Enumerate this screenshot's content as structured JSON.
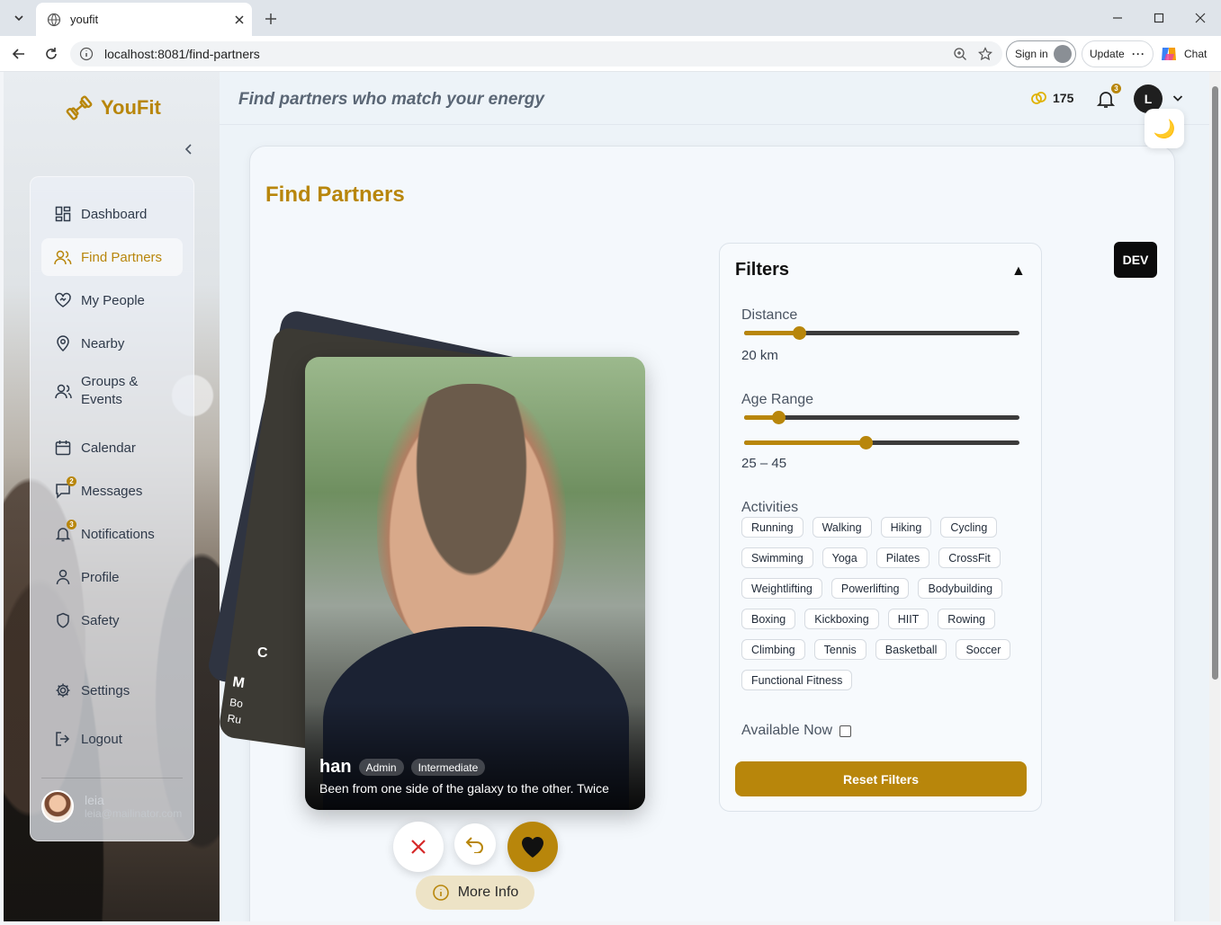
{
  "browser": {
    "tab_title": "youfit",
    "url": "localhost:8081/find-partners",
    "sign_in": "Sign in",
    "update": "Update",
    "chat": "Chat"
  },
  "sidebar": {
    "brand": "YouFit",
    "items": [
      {
        "label": "Dashboard",
        "icon": "dashboard-icon"
      },
      {
        "label": "Find Partners",
        "icon": "users-icon",
        "active": true
      },
      {
        "label": "My People",
        "icon": "heart-handshake-icon"
      },
      {
        "label": "Nearby",
        "icon": "map-pin-icon"
      },
      {
        "label": "Groups & Events",
        "icon": "group-icon"
      },
      {
        "label": "Calendar",
        "icon": "calendar-icon"
      },
      {
        "label": "Messages",
        "icon": "message-icon",
        "badge": "2"
      },
      {
        "label": "Notifications",
        "icon": "bell-icon",
        "badge": "3"
      },
      {
        "label": "Profile",
        "icon": "user-icon"
      },
      {
        "label": "Safety",
        "icon": "shield-icon"
      },
      {
        "label": "Settings",
        "icon": "gear-icon"
      },
      {
        "label": "Logout",
        "icon": "logout-icon"
      }
    ],
    "user": {
      "name": "leia",
      "email": "leia@mailinator.com"
    }
  },
  "topbar": {
    "tagline": "Find partners who match your energy",
    "coins": "175",
    "notif_badge": "3",
    "avatar_letter": "L"
  },
  "page": {
    "title": "Find Partners",
    "dev_badge": "DEV"
  },
  "stack": {
    "back_initial": "C",
    "mid_name": "M",
    "mid_line1": "Bo",
    "mid_line2": "Ru"
  },
  "profile": {
    "name": "han",
    "tags": [
      "Admin",
      "Intermediate"
    ],
    "bio": "Been from one side of the galaxy to the other. Twice",
    "more_info": "More Info"
  },
  "filters": {
    "title": "Filters",
    "toggle": "▲",
    "distance_label": "Distance",
    "distance_value": "20 km",
    "distance_fraction": 0.2,
    "age_label": "Age Range",
    "age_value": "25 – 45",
    "age_min_fraction": 0.125,
    "age_max_fraction": 0.44,
    "activities_label": "Activities",
    "activities": [
      "Running",
      "Walking",
      "Hiking",
      "Cycling",
      "Swimming",
      "Yoga",
      "Pilates",
      "CrossFit",
      "Weightlifting",
      "Powerlifting",
      "Bodybuilding",
      "Boxing",
      "Kickboxing",
      "HIIT",
      "Rowing",
      "Climbing",
      "Tennis",
      "Basketball",
      "Soccer",
      "Functional Fitness"
    ],
    "available_label": "Available Now",
    "reset_label": "Reset Filters"
  },
  "colors": {
    "accent": "#b8860b",
    "like": "#b8860b"
  }
}
